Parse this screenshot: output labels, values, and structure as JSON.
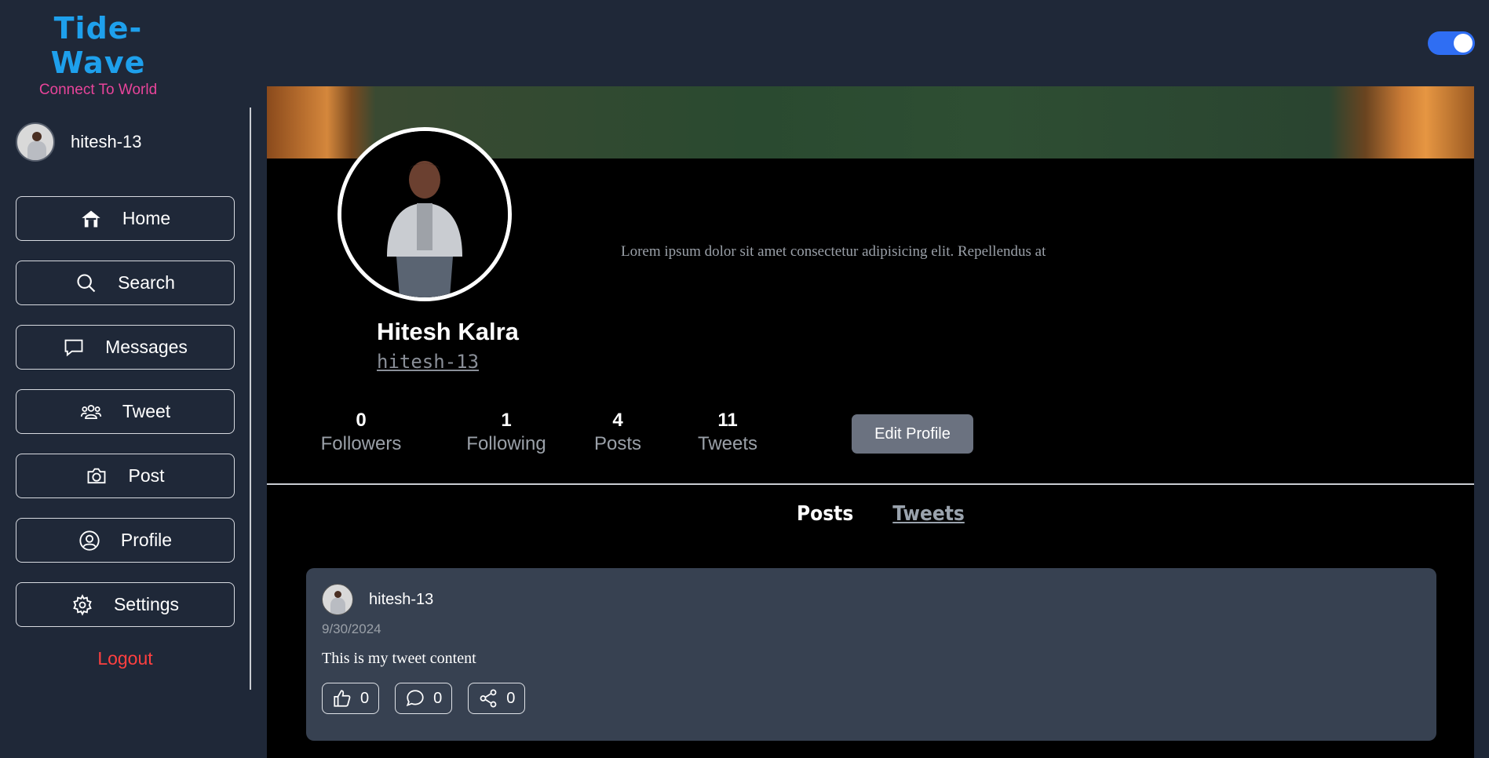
{
  "brand": {
    "title": "Tide-Wave",
    "subtitle": "Connect To World"
  },
  "theme_toggle": {
    "state": "on",
    "color": "#2f6ef3"
  },
  "sidebar": {
    "username": "hitesh-13",
    "items": [
      {
        "label": "Home",
        "icon": "home-icon"
      },
      {
        "label": "Search",
        "icon": "search-icon"
      },
      {
        "label": "Messages",
        "icon": "message-icon"
      },
      {
        "label": "Tweet",
        "icon": "users-icon"
      },
      {
        "label": "Post",
        "icon": "camera-icon"
      },
      {
        "label": "Profile",
        "icon": "user-circle-icon"
      },
      {
        "label": "Settings",
        "icon": "gear-icon"
      }
    ],
    "logout": "Logout"
  },
  "profile": {
    "full_name": "Hitesh Kalra",
    "handle": "hitesh-13",
    "bio": "Lorem ipsum dolor sit amet consectetur adipisicing elit. Repellendus at",
    "stats": [
      {
        "value": "0",
        "label": "Followers"
      },
      {
        "value": "1",
        "label": "Following"
      },
      {
        "value": "4",
        "label": "Posts"
      },
      {
        "value": "11",
        "label": "Tweets"
      }
    ],
    "edit_label": "Edit Profile"
  },
  "tabs": {
    "posts": "Posts",
    "tweets": "Tweets"
  },
  "tweet": {
    "username": "hitesh-13",
    "date": "9/30/2024",
    "content": "This is my tweet content",
    "likes": "0",
    "comments": "0",
    "shares": "0"
  }
}
